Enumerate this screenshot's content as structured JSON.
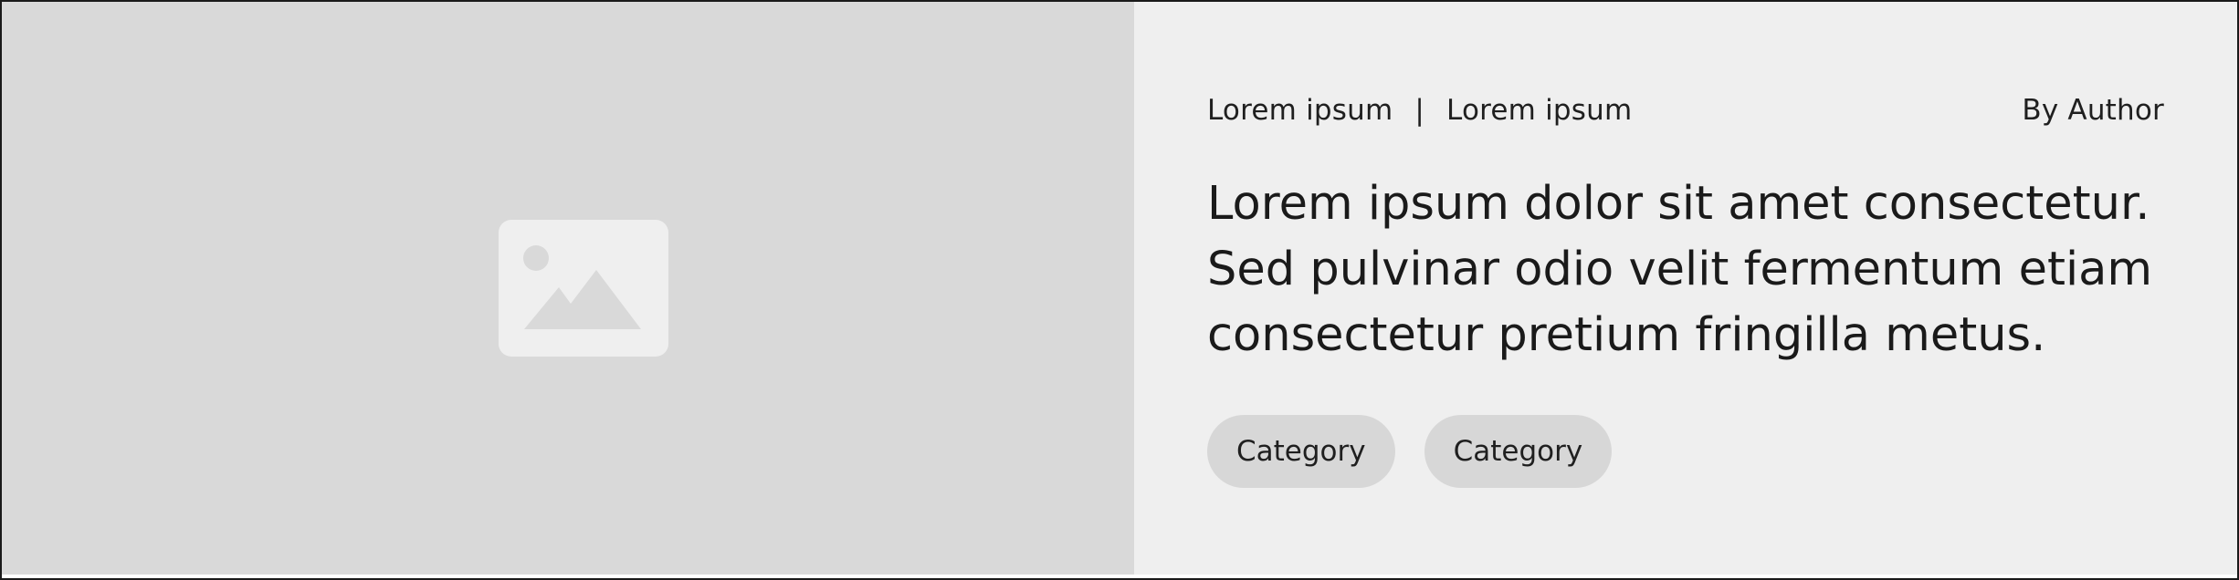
{
  "card": {
    "image": {
      "icon": "image-placeholder-icon",
      "background_color": "#d9d9d9",
      "icon_color": "#efefef"
    },
    "meta": {
      "left_item_1": "Lorem ipsum",
      "separator": "|",
      "left_item_2": "Lorem ipsum",
      "author": "By Author"
    },
    "headline": {
      "lines": [
        "Lorem ipsum dolor sit amet consectetur.",
        "Sed pulvinar odio velit fermentum etiam",
        "consectetur pretium fringilla metus."
      ]
    },
    "tags": [
      {
        "label": "Category"
      },
      {
        "label": "Category"
      }
    ],
    "colors": {
      "content_background": "#efefef",
      "chip_background": "#d7d7d7",
      "text": "#1a1a1a",
      "border": "#1a1a1a"
    }
  }
}
